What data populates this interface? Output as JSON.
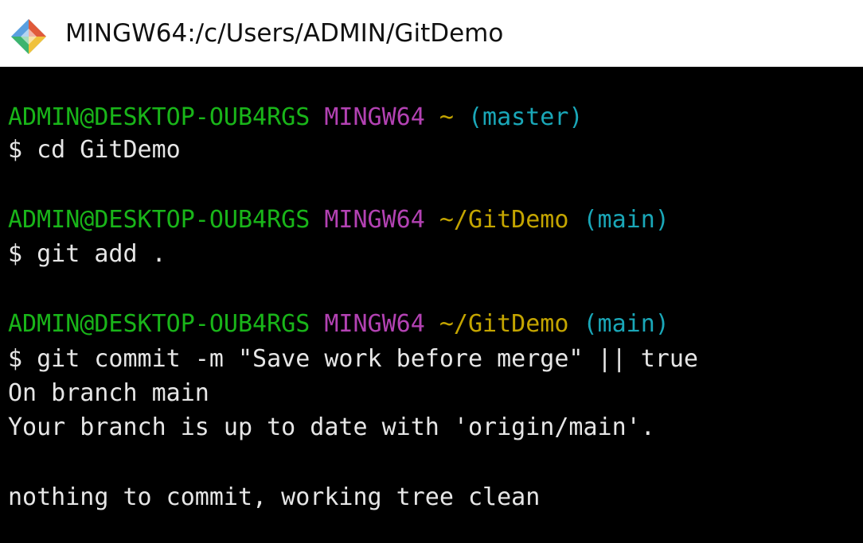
{
  "window": {
    "title": "MINGW64:/c/Users/ADMIN/GitDemo",
    "icon": "git-bash-icon"
  },
  "colors": {
    "user_host": "#19b519",
    "system": "#b342b3",
    "path": "#c4a500",
    "branch": "#1aa7b8",
    "text": "#e6e6e6",
    "background": "#000000"
  },
  "terminal": {
    "prompt1": {
      "user_host": "ADMIN@DESKTOP-OUB4RGS",
      "system": "MINGW64",
      "path": "~",
      "branch": "(master)"
    },
    "command1": "$ cd GitDemo",
    "prompt2": {
      "user_host": "ADMIN@DESKTOP-OUB4RGS",
      "system": "MINGW64",
      "path": "~/GitDemo",
      "branch": "(main)"
    },
    "command2": "$ git add .",
    "prompt3": {
      "user_host": "ADMIN@DESKTOP-OUB4RGS",
      "system": "MINGW64",
      "path": "~/GitDemo",
      "branch": "(main)"
    },
    "command3": "$ git commit -m \"Save work before merge\" || true",
    "output": [
      "On branch main",
      "Your branch is up to date with 'origin/main'.",
      "nothing to commit, working tree clean"
    ]
  }
}
